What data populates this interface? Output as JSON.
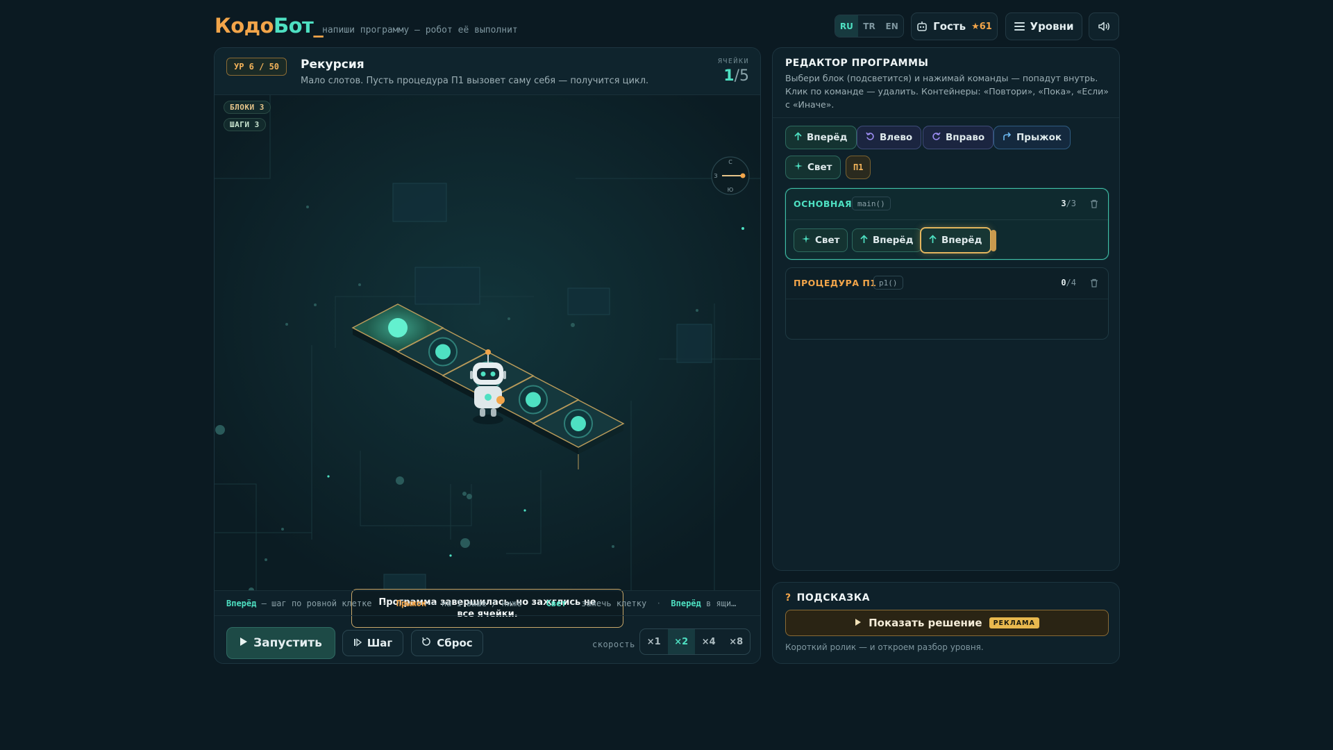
{
  "header": {
    "logo_part1": "Кодо",
    "logo_part2": "Бот",
    "logo_cursor": "_",
    "tagline": "напиши программу — робот её выполнит",
    "languages": [
      "RU",
      "TR",
      "EN"
    ],
    "active_language": "RU",
    "user_label": "Гость",
    "user_stars": "★61",
    "levels_label": "Уровни"
  },
  "level": {
    "badge": "УР 6 / 50",
    "title": "Рекурсия",
    "description": "Мало слотов. Пусть процедура П1 вызовет саму себя — получится цикл.",
    "cells_label": "ЯЧЕЙКИ",
    "cells_lit": "1",
    "cells_total": "/5"
  },
  "stage": {
    "blocks_stat": "БЛОКИ 3",
    "steps_stat": "ШАГИ 3",
    "compass": {
      "n": "С",
      "s": "Ю",
      "w": "З"
    },
    "toast": "Программа завершилась, но зажглись не все ячейки.",
    "cells": [
      {
        "lit": true
      },
      {
        "lit": false
      },
      {
        "lit": false
      },
      {
        "lit": false
      },
      {
        "lit": false
      }
    ],
    "robot_cell": 2
  },
  "legend": {
    "forward_term": "Вперёд",
    "forward_desc": "— шаг по ровной клетке",
    "jump_term": "Прыжок",
    "jump_desc": "— на 1 выше / ниже",
    "light_term": "Свет",
    "light_desc": "— зажечь клетку",
    "forward2_term": "Вперёд",
    "forward2_desc": "в ящи…"
  },
  "controls": {
    "run_label": "Запустить",
    "step_label": "Шаг",
    "reset_label": "Сброс",
    "speed_label": "скорость",
    "speeds": [
      "×1",
      "×2",
      "×4",
      "×8"
    ],
    "active_speed": "×2"
  },
  "editor": {
    "title": "РЕДАКТОР ПРОГРАММЫ",
    "description": "Выбери блок (подсветится) и нажимай команды — попадут внутрь. Клик по команде — удалить. Контейнеры: «Повтори», «Пока», «Если» с «Иначе».",
    "commands": {
      "forward": "Вперёд",
      "left": "Влево",
      "right": "Вправо",
      "jump": "Прыжок",
      "light": "Свет",
      "proc": "П1"
    },
    "main_block": {
      "name": "ОСНОВНАЯ",
      "fn": "main()",
      "count": "3",
      "capacity": "/3",
      "slots": [
        "Свет",
        "Вперёд",
        "Вперёд"
      ]
    },
    "proc_block": {
      "name": "ПРОЦЕДУРА П1",
      "fn": "p1()",
      "count": "0",
      "capacity": "/4"
    }
  },
  "hint": {
    "title": "ПОДСКАЗКА",
    "solve_label": "Показать решение",
    "ad_label": "РЕКЛАМА",
    "note": "Короткий ролик — и откроем разбор уровня."
  },
  "colors": {
    "accent": "#4ee0c2",
    "orange": "#f2a54a",
    "bg": "#0b1a22"
  }
}
